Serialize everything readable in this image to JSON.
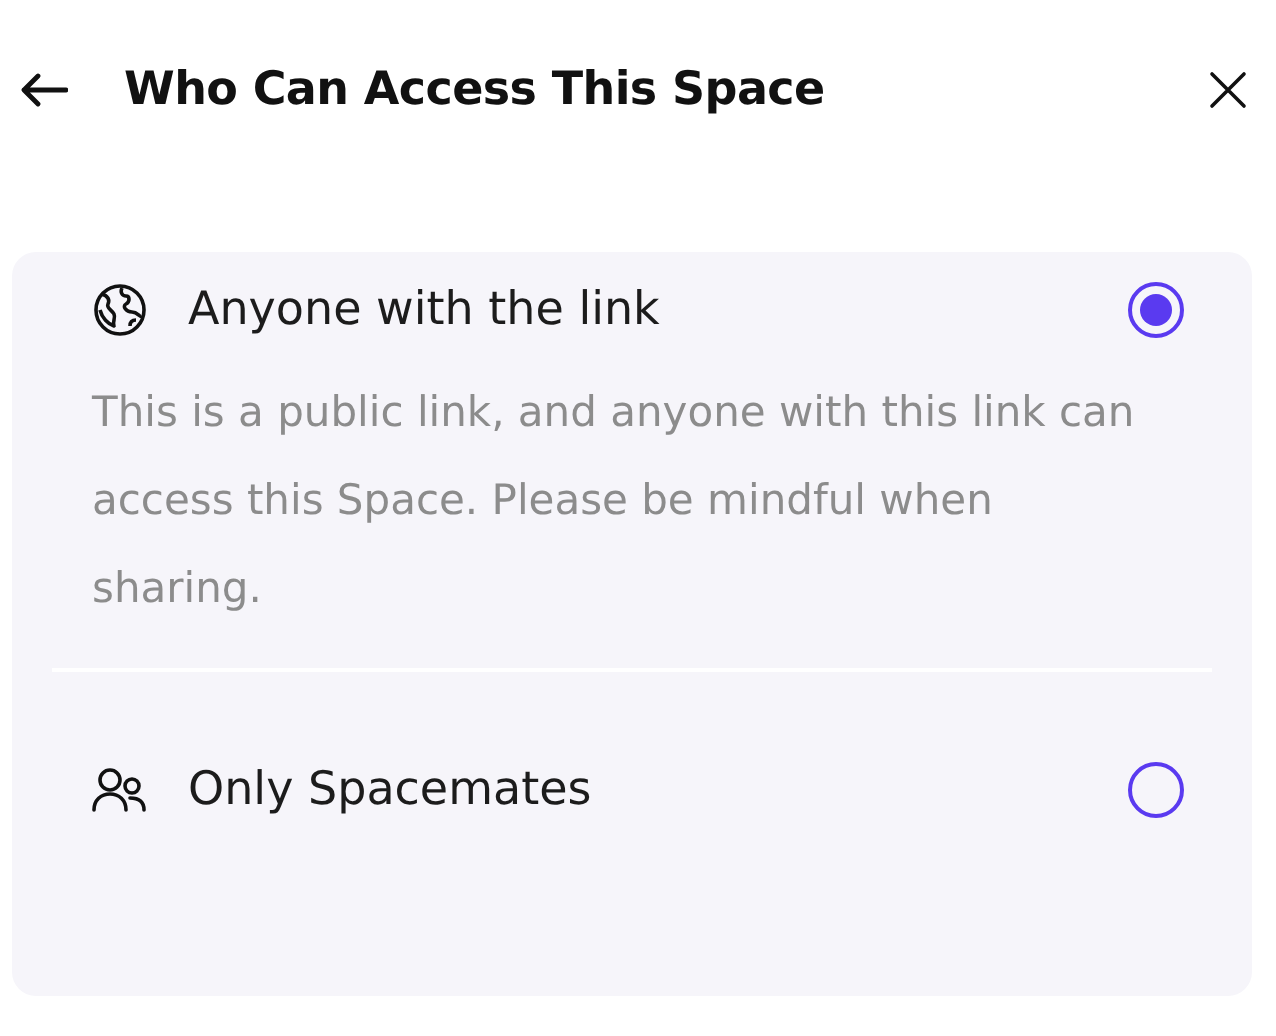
{
  "header": {
    "title": "Who Can Access This Space"
  },
  "options": [
    {
      "kind": "globe",
      "label": "Anyone with the link",
      "selected": true,
      "description": "This is a public link, and anyone with this link can access this Space. Please be mindful when sharing."
    },
    {
      "kind": "people",
      "label": "Only Spacemates",
      "selected": false
    }
  ]
}
